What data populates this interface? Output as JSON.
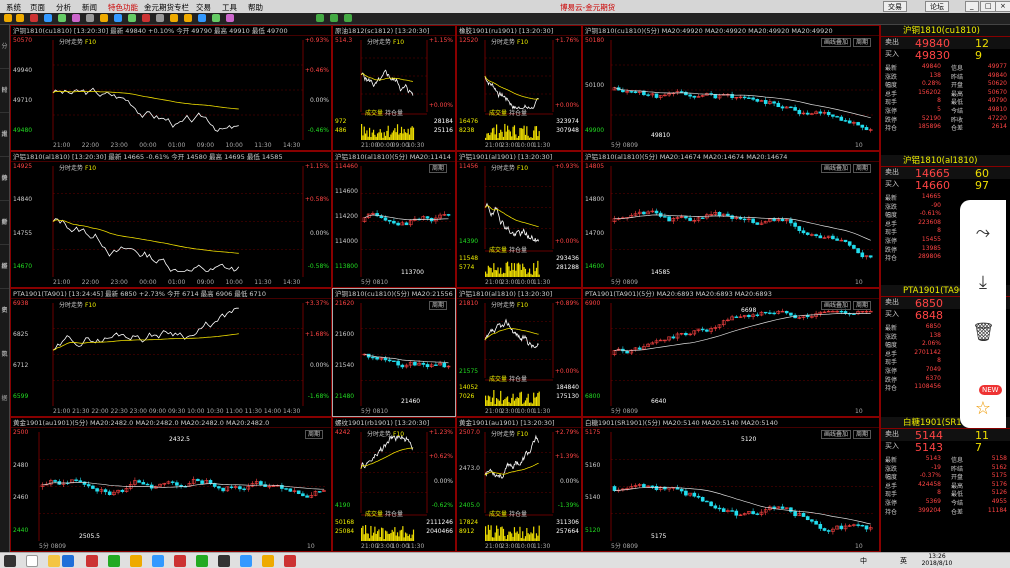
{
  "menu": {
    "items": [
      "系统",
      "页面",
      "分析",
      "新闻",
      "特色功能",
      "金元期货专栏",
      "交易",
      "工具",
      "帮助"
    ],
    "active_item": "特色功能",
    "center_title": "博易云-金元期货",
    "trade_button": "交易",
    "forum_button": "论坛"
  },
  "left_sidebar": [
    "分时走势",
    "技术分析",
    "报价分析",
    "综合排名",
    "财经资讯",
    "历史数据"
  ],
  "panels": [
    {
      "id": "p1",
      "header": "沪铜1810(cu1810) [13:20:30] 最新 49840 +0.10% 今开 49790 最高 49910 最低 49700",
      "tag": "分时走势",
      "tag2": "F10",
      "left_labels": [
        "50570",
        "49940",
        "49710",
        "49480"
      ],
      "right_labels": [
        "+0.93%",
        "+0.46%",
        "0.00%",
        "-0.46%"
      ],
      "x_labels": [
        "21:00",
        "22:00",
        "23:00",
        "00:00",
        "01:00",
        "09:00",
        "10:00",
        "11:30",
        "14:30"
      ]
    },
    {
      "id": "p2",
      "header": "原油1812(sc1812) [13:20:30]",
      "tag": "分时走势",
      "tag2": "F10",
      "left_labels": [
        "514.3"
      ],
      "right_labels": [
        "+1.15%",
        "+0.00%"
      ],
      "x_labels": [
        "21:00",
        "00:00",
        "09:00",
        "10:30"
      ],
      "vol_label": "成交量",
      "oi_label": "持仓量",
      "stats": [
        [
          "972",
          "28184"
        ],
        [
          "486",
          "25116"
        ]
      ]
    },
    {
      "id": "p3",
      "header": "橡胶1901(ru1901) [13:20:30]",
      "tag": "分时走势",
      "tag2": "F10",
      "left_labels": [
        "12520"
      ],
      "right_labels": [
        "+1.76%",
        "+0.00%"
      ],
      "x_labels": [
        "21:00",
        "23:00",
        "10:00",
        "11:30"
      ],
      "vol_label": "成交量",
      "oi_label": "持仓量",
      "stats": [
        [
          "16476",
          "323974"
        ],
        [
          "8238",
          "307948"
        ]
      ]
    },
    {
      "id": "p4",
      "header": "沪铜1810(cu1810)(5分) MA20:49920 MA20:49920 MA20:49920 MA20:49920",
      "btns": [
        "画线叠加",
        "周期"
      ],
      "left_labels": [
        "50180",
        "50100",
        "49900"
      ],
      "x_labels": [
        "5分 0809",
        "10"
      ],
      "marks": [
        "49810"
      ]
    },
    {
      "id": "p5",
      "header": "沪铝1810(al1810) [13:20:30] 最新 14665 -0.61% 今开 14580 最高 14695 最低 14585",
      "tag": "分时走势",
      "tag2": "F10",
      "left_labels": [
        "14925",
        "14840",
        "14755",
        "14670"
      ],
      "right_labels": [
        "+1.15%",
        "+0.58%",
        "0.00%",
        "-0.58%"
      ],
      "x_labels": [
        "21:00",
        "22:00",
        "23:00",
        "00:00",
        "01:00",
        "09:00",
        "10:00",
        "11:30",
        "14:30"
      ]
    },
    {
      "id": "p6",
      "header": "沪铝1810(al1810)(5分) MA20:11414",
      "btns": [
        "周期"
      ],
      "left_labels": [
        "114460",
        "114600",
        "114200",
        "114000",
        "113800"
      ],
      "x_labels": [
        "5分 0810"
      ],
      "marks": [
        "113700"
      ]
    },
    {
      "id": "p7",
      "header": "沪铝1901(al1901) [13:20:30]",
      "tag": "分时走势",
      "tag2": "F10",
      "left_labels": [
        "11456",
        "14390"
      ],
      "right_labels": [
        "+0.93%",
        "+0.00%"
      ],
      "x_labels": [
        "21:00",
        "23:00",
        "10:00",
        "11:30"
      ],
      "vol_label": "成交量",
      "oi_label": "持仓量",
      "stats": [
        [
          "11548",
          "293436"
        ],
        [
          "5774",
          "281288"
        ]
      ]
    },
    {
      "id": "p8",
      "header": "沪铝1810(al1810)(5分) MA20:14674 MA20:14674 MA20:14674",
      "btns": [
        "画线叠加",
        "周期"
      ],
      "left_labels": [
        "14805",
        "14800",
        "14700",
        "14600"
      ],
      "x_labels": [
        "5分 0809",
        "10"
      ],
      "marks": [
        "14585"
      ]
    },
    {
      "id": "p9",
      "header": "PTA1901(TA901) [13:24:45] 最新 6850 +2.73% 今开 6714 最高 6906 最低 6710",
      "tag": "分时走势",
      "tag2": "F10",
      "left_labels": [
        "6938",
        "6825",
        "6712",
        "6599"
      ],
      "right_labels": [
        "+3.37%",
        "+1.68%",
        "0.00%",
        "-1.68%"
      ],
      "x_labels": [
        "21:00",
        "21:30",
        "22:00",
        "22:30",
        "23:00",
        "09:00",
        "09:30",
        "10:00",
        "10:30",
        "11:00",
        "11:30",
        "14:00",
        "14:30"
      ]
    },
    {
      "id": "p10",
      "header": "沪铜1810(cu1810)(5分) MA20:21556 MA20:21556",
      "btns": [
        "周期"
      ],
      "left_labels": [
        "21620",
        "21600",
        "21540",
        "21480"
      ],
      "x_labels": [
        "5分 0810"
      ],
      "marks": [
        "21460"
      ]
    },
    {
      "id": "p11",
      "header": "沪铝1810(al1810) [13:20:30]",
      "tag": "分时走势",
      "tag2": "F10",
      "left_labels": [
        "21810",
        "21575"
      ],
      "right_labels": [
        "+0.89%",
        "+0.00%"
      ],
      "x_labels": [
        "21:00",
        "23:00",
        "10:00",
        "11:30"
      ],
      "vol_label": "成交量",
      "oi_label": "持仓量",
      "stats": [
        [
          "14052",
          "184840"
        ],
        [
          "7026",
          "175130"
        ]
      ]
    },
    {
      "id": "p12",
      "header": "PTA1901(TA901)(5分) MA20:6893 MA20:6893 MA20:6893",
      "btns": [
        "画线叠加",
        "周期"
      ],
      "left_labels": [
        "6900",
        "6800"
      ],
      "x_labels": [
        "5分 0809",
        "10"
      ],
      "marks": [
        "6640",
        "6698"
      ]
    },
    {
      "id": "p13",
      "header": "黄金1901(au1901)(5分) MA20:2482.0 MA20:2482.0 MA20:2482.0 MA20:2482.0",
      "btns": [
        "周期"
      ],
      "left_labels": [
        "2500",
        "2480",
        "2460",
        "2440"
      ],
      "x_labels": [
        "5分 0809",
        "10"
      ],
      "marks": [
        "2505.5",
        "2432.5"
      ]
    },
    {
      "id": "p14",
      "header": "螺纹1901(rb1901) [13:20:30]",
      "tag": "分时走势",
      "tag2": "F10",
      "left_labels": [
        "4242",
        "4190"
      ],
      "right_labels": [
        "+1.23%",
        "+0.62%",
        "0.00%",
        "-0.62%"
      ],
      "x_labels": [
        "21:00",
        "23:00",
        "10:00",
        "11:30"
      ],
      "vol_label": "成交量",
      "oi_label": "持仓量",
      "stats": [
        [
          "50168",
          "2111246"
        ],
        [
          "25084",
          "2040466"
        ]
      ]
    },
    {
      "id": "p15",
      "header": "黄金1901(au1901) [13:20:30]",
      "tag": "分时走势",
      "tag2": "F10",
      "left_labels": [
        "2507.0",
        "2473.0",
        "2405.0"
      ],
      "right_labels": [
        "+2.79%",
        "+1.39%",
        "0.00%",
        "-1.39%"
      ],
      "x_labels": [
        "21:00",
        "23:00",
        "10:00",
        "11:30"
      ],
      "vol_label": "成交量",
      "oi_label": "持仓量",
      "stats": [
        [
          "17824",
          "311306"
        ],
        [
          "8912",
          "257664"
        ]
      ]
    },
    {
      "id": "p16",
      "header": "白糖1901(SR1901)(5分) MA20:5140 MA20:5140 MA20:5140",
      "btns": [
        "画线叠加",
        "周期"
      ],
      "left_labels": [
        "5175",
        "5160",
        "5140",
        "5120"
      ],
      "x_labels": [
        "5分 0809",
        "10"
      ],
      "marks": [
        "5175",
        "5120"
      ]
    }
  ],
  "quotes": [
    {
      "title": "沪铜1810(cu1810)",
      "sell_label": "卖出",
      "sell_price": "49840",
      "sell_vol": "12",
      "buy_label": "买入",
      "buy_price": "49830",
      "buy_vol": "9",
      "rows": [
        [
          "最新",
          "49840",
          "信息",
          "49977"
        ],
        [
          "涨跌",
          "138",
          "昨结",
          "49840"
        ],
        [
          "幅度",
          "0.28%",
          "开盘",
          "50620"
        ],
        [
          "总手",
          "156202",
          "最高",
          "50670"
        ],
        [
          "现手",
          "8",
          "最低",
          "49790"
        ],
        [
          "涨停",
          "5",
          "今结",
          "49810"
        ],
        [
          "跌停",
          "52190",
          "昨收",
          "47220"
        ],
        [
          "持仓",
          "185896",
          "仓差",
          "2614"
        ]
      ]
    },
    {
      "title": "沪铝1810(al1810)",
      "sell_label": "卖出",
      "sell_price": "14665",
      "sell_vol": "60",
      "buy_label": "买入",
      "buy_price": "14660",
      "buy_vol": "97",
      "rows": [
        [
          "最新",
          "14665",
          "",
          " "
        ],
        [
          "涨跌",
          "-90",
          "",
          " "
        ],
        [
          "幅度",
          "-0.61%",
          "",
          " "
        ],
        [
          "总手",
          "223608",
          "",
          " "
        ],
        [
          "现手",
          "8",
          "",
          " "
        ],
        [
          "涨停",
          "15455",
          "",
          " "
        ],
        [
          "跌停",
          "13985",
          "",
          " "
        ],
        [
          "持仓",
          "289806",
          "",
          " "
        ]
      ]
    },
    {
      "title": "PTA1901(TA901)",
      "sell_label": "卖出",
      "sell_price": "6850",
      "sell_vol": "244",
      "buy_label": "买入",
      "buy_price": "6848",
      "buy_vol": "68",
      "rows": [
        [
          "最新",
          "6850",
          "",
          " "
        ],
        [
          "涨跌",
          "138",
          "",
          " "
        ],
        [
          "幅度",
          "2.06%",
          "",
          " "
        ],
        [
          "总手",
          "2701142",
          "",
          " "
        ],
        [
          "现手",
          "8",
          "",
          " "
        ],
        [
          "涨停",
          "7049",
          "",
          " "
        ],
        [
          "跌停",
          "6370",
          "",
          " "
        ],
        [
          "持仓",
          "1108456",
          "",
          " "
        ]
      ]
    },
    {
      "title": "白糖1901(SR1901)",
      "sell_label": "卖出",
      "sell_price": "5144",
      "sell_vol": "11",
      "buy_label": "买入",
      "buy_price": "5143",
      "buy_vol": "7",
      "rows": [
        [
          "最新",
          "5143",
          "信息",
          "5158"
        ],
        [
          "涨跌",
          "-19",
          "昨结",
          "5162"
        ],
        [
          "幅度",
          "-0.37%",
          "开盘",
          "5175"
        ],
        [
          "总手",
          "424458",
          "最高",
          "5176"
        ],
        [
          "现手",
          "8",
          "最低",
          "5126"
        ],
        [
          "涨停",
          "5369",
          "今结",
          "4955"
        ],
        [
          "持仓",
          "399204",
          "仓差",
          "11184"
        ]
      ]
    }
  ],
  "overlay_labels": {
    "pta_float_title": "901 (TA",
    "pta_side1": "现手",
    "pta_side2": "涨停"
  },
  "floating_menu": {
    "new_badge": "NEW"
  },
  "taskbar": {
    "time": "13:26",
    "date": "2018/8/10",
    "ime": "英",
    "lang": "中"
  },
  "colors": {
    "up": "#ff4444",
    "down": "#22dd22",
    "ma": "#eedd00",
    "grid": "#800000"
  }
}
